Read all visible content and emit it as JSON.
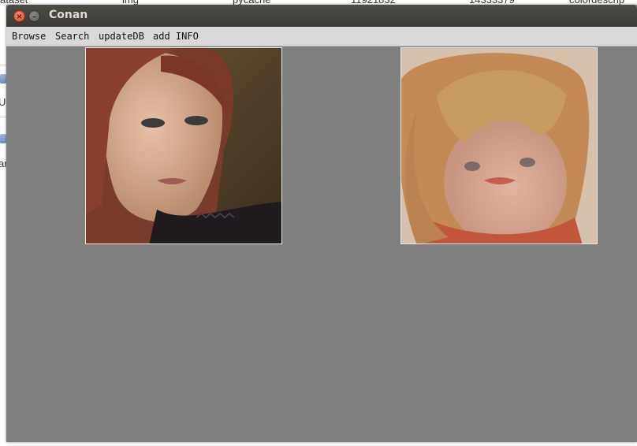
{
  "window": {
    "title": "Conan"
  },
  "menu": {
    "items": [
      "Browse",
      "Search",
      "updateDB",
      "add INFO"
    ]
  },
  "background_strip": {
    "labels": [
      "ataset",
      "img",
      "pycache",
      "11921832",
      "14333379",
      "colordescrip"
    ]
  },
  "background_left": {
    "letters": [
      "U",
      "ar"
    ]
  },
  "images": {
    "query": {
      "name": "query-photo"
    },
    "result": {
      "name": "result-photo"
    }
  }
}
